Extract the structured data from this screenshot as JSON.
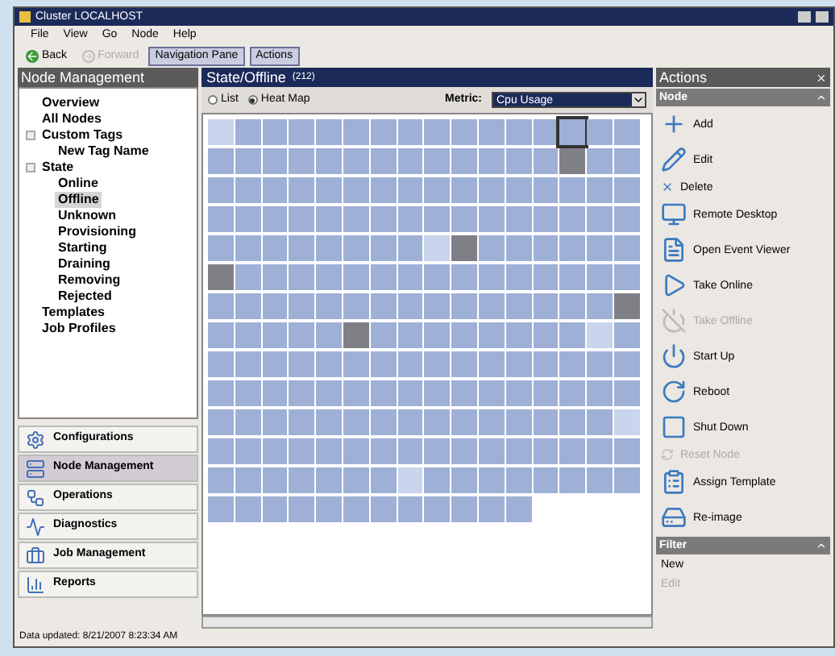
{
  "window": {
    "title": "Cluster LOCALHOST"
  },
  "menu": [
    "File",
    "View",
    "Go",
    "Node",
    "Help"
  ],
  "toolbar": [
    {
      "label": "Back",
      "disabled": false,
      "pressed": false
    },
    {
      "label": "Forward",
      "disabled": true,
      "pressed": false
    },
    {
      "label": "Navigation Pane",
      "disabled": false,
      "pressed": true
    },
    {
      "label": "Actions",
      "disabled": false,
      "pressed": true
    }
  ],
  "navigation": {
    "title": "Node Management",
    "tree": [
      {
        "label": "Overview",
        "selected": false
      },
      {
        "label": "All Nodes",
        "selected": false
      },
      {
        "label": "Custom Tags",
        "selected": false,
        "children": [
          {
            "label": "New Tag Name",
            "selected": false
          }
        ]
      },
      {
        "label": "State",
        "selected": false,
        "children": [
          {
            "label": "Online",
            "selected": false
          },
          {
            "label": "Offline",
            "selected": true
          },
          {
            "label": "Unknown",
            "selected": false
          },
          {
            "label": "Provisioning",
            "selected": false
          },
          {
            "label": "Starting",
            "selected": false
          },
          {
            "label": "Draining",
            "selected": false
          },
          {
            "label": "Removing",
            "selected": false
          },
          {
            "label": "Rejected",
            "selected": false
          }
        ]
      },
      {
        "label": "Templates",
        "selected": false
      },
      {
        "label": "Job Profiles",
        "selected": false
      }
    ],
    "sections": [
      {
        "label": "Configurations",
        "selected": false
      },
      {
        "label": "Node Management",
        "selected": true
      },
      {
        "label": "Operations",
        "selected": false
      },
      {
        "label": "Diagnostics",
        "selected": false
      },
      {
        "label": "Job Management",
        "selected": false
      },
      {
        "label": "Reports",
        "selected": false
      }
    ]
  },
  "content": {
    "title": "State/Offline",
    "count": "(212)",
    "views": [
      {
        "label": "List",
        "selected": false
      },
      {
        "label": "Heat Map",
        "selected": true
      }
    ],
    "metric_label": "Metric:",
    "metric": "Cpu Usage"
  },
  "actions": {
    "title": "Actions",
    "groups": [
      {
        "title": "Node",
        "items": [
          {
            "label": "Add",
            "kind": "large",
            "disabled": false
          },
          {
            "label": "Edit",
            "kind": "large",
            "disabled": false
          },
          {
            "label": "Delete",
            "kind": "small",
            "disabled": false
          },
          {
            "label": "Remote Desktop",
            "kind": "large",
            "disabled": false
          },
          {
            "label": "Open Event Viewer",
            "kind": "large",
            "disabled": false
          },
          {
            "label": "Take Online",
            "kind": "large",
            "disabled": false
          },
          {
            "label": "Take Offline",
            "kind": "large",
            "disabled": true
          },
          {
            "label": "Start Up",
            "kind": "large",
            "disabled": false
          },
          {
            "label": "Reboot",
            "kind": "large",
            "disabled": false
          },
          {
            "label": "Shut Down",
            "kind": "large",
            "disabled": false
          },
          {
            "label": "Reset Node",
            "kind": "small",
            "disabled": true
          },
          {
            "label": "Assign Template",
            "kind": "large",
            "disabled": false
          },
          {
            "label": "Re-image",
            "kind": "large",
            "disabled": false
          }
        ]
      },
      {
        "title": "Filter",
        "items": [
          {
            "label": "New",
            "kind": "small",
            "disabled": false
          },
          {
            "label": "Edit",
            "kind": "small",
            "disabled": true
          }
        ]
      }
    ]
  },
  "status_bar": "Data updated: 8/21/2007 8:23:34 AM"
}
